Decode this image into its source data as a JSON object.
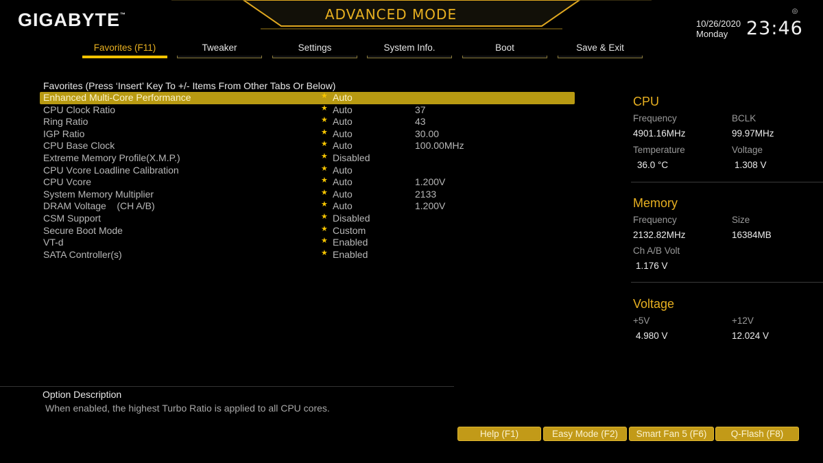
{
  "brand": {
    "name": "GIGABYTE",
    "trademark": "™"
  },
  "header": {
    "mode_title": "ADVANCED MODE",
    "date": "10/26/2020",
    "day": "Monday",
    "time": "23:46"
  },
  "tabs": [
    {
      "label": "Favorites (F11)",
      "active": true
    },
    {
      "label": "Tweaker",
      "active": false
    },
    {
      "label": "Settings",
      "active": false
    },
    {
      "label": "System Info.",
      "active": false
    },
    {
      "label": "Boot",
      "active": false
    },
    {
      "label": "Save & Exit",
      "active": false
    }
  ],
  "favorites": {
    "heading": "Favorites (Press ‘Insert’ Key To +/- Items From Other Tabs Or Below)",
    "items": [
      {
        "label": "Enhanced Multi-Core Performance",
        "value": "Auto",
        "current": ""
      },
      {
        "label": "CPU Clock Ratio",
        "value": "Auto",
        "current": "37"
      },
      {
        "label": "Ring Ratio",
        "value": "Auto",
        "current": "43"
      },
      {
        "label": "IGP Ratio",
        "value": "Auto",
        "current": "30.00"
      },
      {
        "label": "CPU Base Clock",
        "value": "Auto",
        "current": "100.00MHz"
      },
      {
        "label": "Extreme Memory Profile(X.M.P.)",
        "value": "Disabled",
        "current": ""
      },
      {
        "label": "CPU Vcore Loadline Calibration",
        "value": "Auto",
        "current": ""
      },
      {
        "label": "CPU Vcore",
        "value": "Auto",
        "current": "1.200V"
      },
      {
        "label": "System Memory Multiplier",
        "value": "Auto",
        "current": "2133"
      },
      {
        "label": "DRAM Voltage    (CH A/B)",
        "value": "Auto",
        "current": "1.200V"
      },
      {
        "label": "CSM Support",
        "value": "Disabled",
        "current": ""
      },
      {
        "label": "Secure Boot Mode",
        "value": "Custom",
        "current": ""
      },
      {
        "label": "VT-d",
        "value": "Enabled",
        "current": ""
      },
      {
        "label": "SATA Controller(s)",
        "value": "Enabled",
        "current": ""
      }
    ],
    "star_icon": "★"
  },
  "cpu": {
    "title": "CPU",
    "frequency_label": "Frequency",
    "frequency": "4901.16MHz",
    "bclk_label": "BCLK",
    "bclk": "99.97MHz",
    "temperature_label": "Temperature",
    "temperature": "36.0 °C",
    "voltage_label": "Voltage",
    "voltage": "1.308 V"
  },
  "memory": {
    "title": "Memory",
    "frequency_label": "Frequency",
    "frequency": "2132.82MHz",
    "size_label": "Size",
    "size": "16384MB",
    "volt_label": "Ch A/B Volt",
    "volt": "1.176 V"
  },
  "voltage": {
    "title": "Voltage",
    "v5_label": "+5V",
    "v5": "4.980 V",
    "v12_label": "+12V",
    "v12": "12.024 V"
  },
  "option_description": {
    "title": "Option Description",
    "text": "When enabled, the highest Turbo Ratio is applied to all CPU cores."
  },
  "buttons": [
    {
      "label": "Help (F1)"
    },
    {
      "label": "Easy Mode (F2)"
    },
    {
      "label": "Smart Fan 5 (F6)"
    },
    {
      "label": "Q-Flash (F8)"
    }
  ],
  "colors": {
    "accent": "#e8b020",
    "highlight": "#b89a12",
    "background": "#000000"
  }
}
